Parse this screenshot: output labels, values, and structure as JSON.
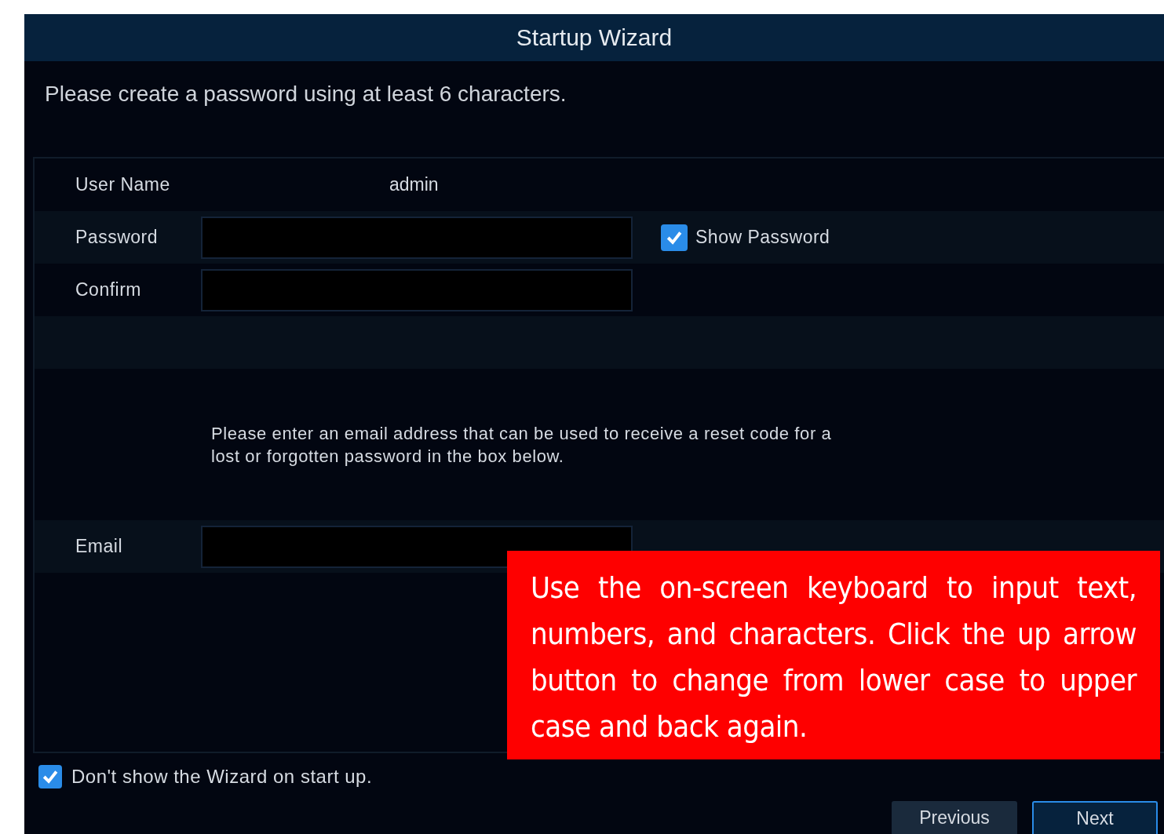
{
  "window": {
    "title": "Startup Wizard"
  },
  "intro": "Please create a password using at least 6 characters.",
  "user": {
    "label": "User Name",
    "value": "admin"
  },
  "password": {
    "label": "Password"
  },
  "show_password": {
    "label": "Show Password",
    "checked": true
  },
  "confirm": {
    "label": "Confirm"
  },
  "email_note": "Please enter an email address that can be used to receive a reset code for a lost or forgotten password in the box below.",
  "email": {
    "label": "Email"
  },
  "callout": "Use the on-screen keyboard to input text, numbers, and characters. Click the up arrow button to change from lower case to upper case and back again.",
  "dont_show": {
    "label": "Don't show the Wizard on start up.",
    "checked": true
  },
  "buttons": [
    {
      "label": "Previous",
      "selected": false
    },
    {
      "label": "Next",
      "selected": true
    }
  ]
}
